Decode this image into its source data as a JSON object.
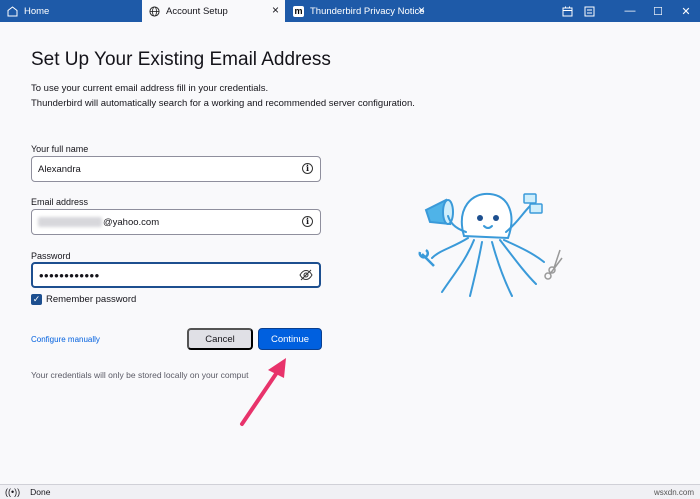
{
  "tabs": [
    {
      "label": "Home",
      "icon": "home-icon"
    },
    {
      "label": "Account Setup",
      "icon": "globe-icon"
    },
    {
      "label": "Thunderbird Privacy Notice",
      "icon": "m-logo-icon"
    }
  ],
  "page": {
    "title": "Set Up Your Existing Email Address",
    "intro_line1": "To use your current email address fill in your credentials.",
    "intro_line2": "Thunderbird will automatically search for a working and recommended server configuration."
  },
  "form": {
    "name_label": "Your full name",
    "name_value": "Alexandra",
    "email_label": "Email address",
    "email_domain": "@yahoo.com",
    "password_label": "Password",
    "password_value": "••••••••••••",
    "remember_label": "Remember password",
    "remember_checked": true
  },
  "actions": {
    "configure_label": "Configure manually",
    "cancel_label": "Cancel",
    "continue_label": "Continue"
  },
  "footnote": "Your credentials will only be stored locally on your comput",
  "status": {
    "text": "Done"
  },
  "watermark": "wsxdn.com",
  "colors": {
    "tabbar": "#1e5aa8",
    "accent": "#0060df",
    "arrow": "#e8336b",
    "octopus": "#4fb3e8"
  }
}
